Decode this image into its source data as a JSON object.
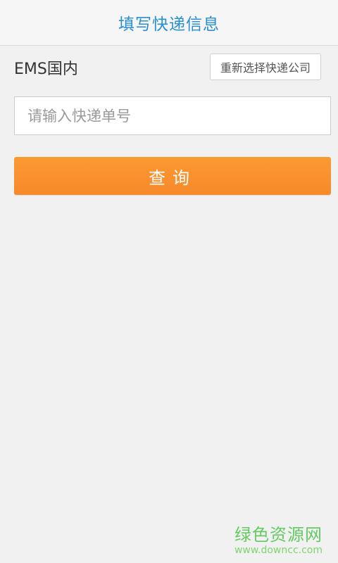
{
  "header": {
    "title": "填写快递信息"
  },
  "company": {
    "name": "EMS国内",
    "reselect_label": "重新选择快递公司"
  },
  "tracking": {
    "value": "",
    "placeholder": "请输入快递单号"
  },
  "query": {
    "label": "查询"
  },
  "watermark": {
    "text": "绿色资源网",
    "url": "www.downcc.com"
  },
  "colors": {
    "header_title": "#2a8fd1",
    "query_button": "#f8892a",
    "watermark": "#4cc44a"
  }
}
